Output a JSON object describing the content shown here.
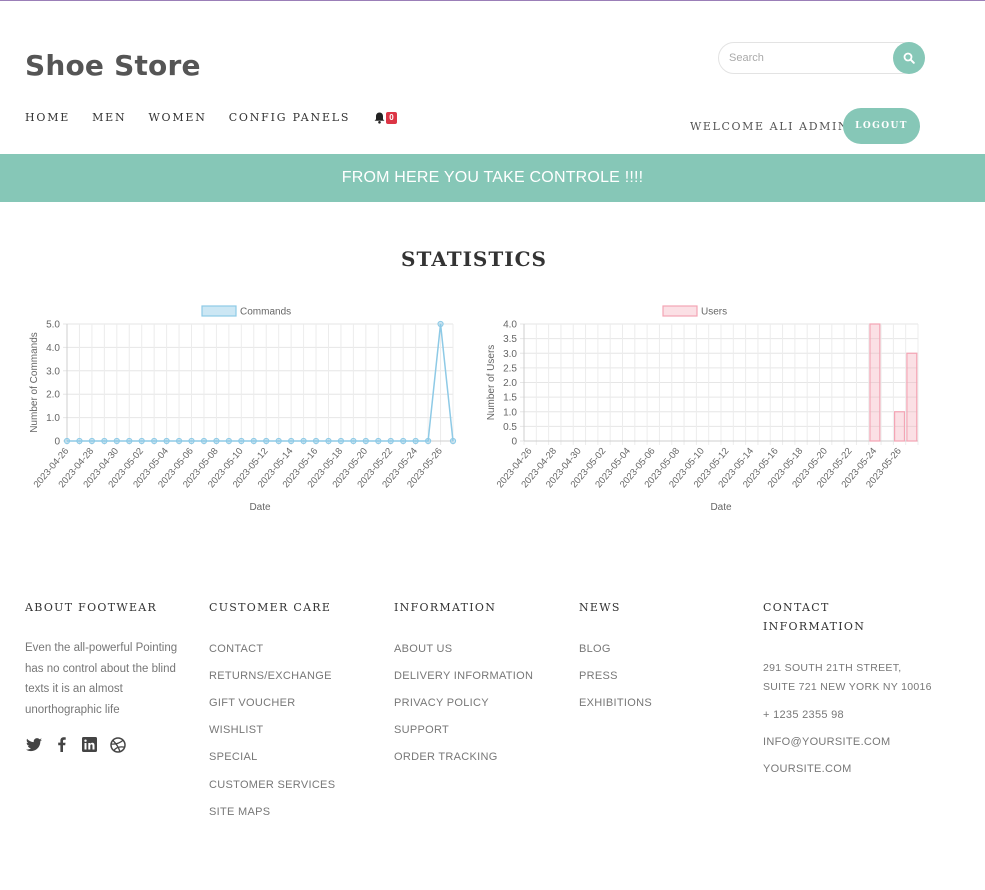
{
  "header": {
    "brand": "Shoe Store",
    "search_placeholder": "Search",
    "nav": [
      "HOME",
      "MEN",
      "WOMEN",
      "CONFIG PANELS"
    ],
    "notification_count": "0",
    "welcome": "WELCOME ALI ADMIN",
    "logout_label": "LOGOUT"
  },
  "banner": {
    "text": "FROM HERE YOU TAKE CONTROLE !!!!"
  },
  "stats": {
    "title": "STATISTICS"
  },
  "colors": {
    "accent": "#86c7b7",
    "badge": "#dc3545",
    "commands_line": "#8ecae6",
    "users_bar": "#f4a5b5"
  },
  "chart_data": [
    {
      "type": "line",
      "legend": "Commands",
      "xlabel": "Date",
      "ylabel": "Number of Commands",
      "ylim": [
        0,
        5
      ],
      "yticks": [
        "0",
        "1.0",
        "2.0",
        "3.0",
        "4.0",
        "5.0"
      ],
      "x": [
        "2023-04-26",
        "2023-04-27",
        "2023-04-28",
        "2023-04-29",
        "2023-04-30",
        "2023-05-01",
        "2023-05-02",
        "2023-05-03",
        "2023-05-04",
        "2023-05-05",
        "2023-05-06",
        "2023-05-07",
        "2023-05-08",
        "2023-05-09",
        "2023-05-10",
        "2023-05-11",
        "2023-05-12",
        "2023-05-13",
        "2023-05-14",
        "2023-05-15",
        "2023-05-16",
        "2023-05-17",
        "2023-05-18",
        "2023-05-19",
        "2023-05-20",
        "2023-05-21",
        "2023-05-22",
        "2023-05-23",
        "2023-05-24",
        "2023-05-25",
        "2023-05-26",
        "2023-05-27"
      ],
      "xtick_labels": [
        "2023-04-26",
        "2023-04-28",
        "2023-04-30",
        "2023-05-02",
        "2023-05-04",
        "2023-05-06",
        "2023-05-08",
        "2023-05-10",
        "2023-05-12",
        "2023-05-14",
        "2023-05-16",
        "2023-05-18",
        "2023-05-20",
        "2023-05-22",
        "2023-05-24",
        "2023-05-26"
      ],
      "values": [
        0,
        0,
        0,
        0,
        0,
        0,
        0,
        0,
        0,
        0,
        0,
        0,
        0,
        0,
        0,
        0,
        0,
        0,
        0,
        0,
        0,
        0,
        0,
        0,
        0,
        0,
        0,
        0,
        0,
        0,
        5,
        0
      ]
    },
    {
      "type": "bar",
      "legend": "Users",
      "xlabel": "Date",
      "ylabel": "Number of Users",
      "ylim": [
        0,
        4
      ],
      "yticks": [
        "0",
        "0.5",
        "1.0",
        "1.5",
        "2.0",
        "2.5",
        "3.0",
        "3.5",
        "4.0"
      ],
      "x": [
        "2023-04-26",
        "2023-04-27",
        "2023-04-28",
        "2023-04-29",
        "2023-04-30",
        "2023-05-01",
        "2023-05-02",
        "2023-05-03",
        "2023-05-04",
        "2023-05-05",
        "2023-05-06",
        "2023-05-07",
        "2023-05-08",
        "2023-05-09",
        "2023-05-10",
        "2023-05-11",
        "2023-05-12",
        "2023-05-13",
        "2023-05-14",
        "2023-05-15",
        "2023-05-16",
        "2023-05-17",
        "2023-05-18",
        "2023-05-19",
        "2023-05-20",
        "2023-05-21",
        "2023-05-22",
        "2023-05-23",
        "2023-05-24",
        "2023-05-25",
        "2023-05-26",
        "2023-05-27"
      ],
      "xtick_labels": [
        "2023-04-26",
        "2023-04-28",
        "2023-04-30",
        "2023-05-02",
        "2023-05-04",
        "2023-05-06",
        "2023-05-08",
        "2023-05-10",
        "2023-05-12",
        "2023-05-14",
        "2023-05-16",
        "2023-05-18",
        "2023-05-20",
        "2023-05-22",
        "2023-05-24",
        "2023-05-26"
      ],
      "values": [
        0,
        0,
        0,
        0,
        0,
        0,
        0,
        0,
        0,
        0,
        0,
        0,
        0,
        0,
        0,
        0,
        0,
        0,
        0,
        0,
        0,
        0,
        0,
        0,
        0,
        0,
        0,
        0,
        4,
        0,
        1,
        3
      ]
    }
  ],
  "footer": {
    "about": {
      "title": "ABOUT FOOTWEAR",
      "text": "Even the all-powerful Pointing has no control about the blind texts it is an almost unorthographic life",
      "social": [
        "twitter-icon",
        "facebook-icon",
        "linkedin-icon",
        "dribbble-icon"
      ]
    },
    "customer_care": {
      "title": "CUSTOMER CARE",
      "links": [
        "CONTACT",
        "RETURNS/EXCHANGE",
        "GIFT VOUCHER",
        "WISHLIST",
        "SPECIAL",
        "CUSTOMER SERVICES",
        "SITE MAPS"
      ]
    },
    "information": {
      "title": "INFORMATION",
      "links": [
        "ABOUT US",
        "DELIVERY INFORMATION",
        "PRIVACY POLICY",
        "SUPPORT",
        "ORDER TRACKING"
      ]
    },
    "news": {
      "title": "NEWS",
      "links": [
        "BLOG",
        "PRESS",
        "EXHIBITIONS"
      ]
    },
    "contact": {
      "title_line1": "CONTACT",
      "title_line2": "INFORMATION",
      "address_line1": "291 SOUTH 21TH STREET,",
      "address_line2": "SUITE 721 NEW YORK NY 10016",
      "phone": "+ 1235 2355 98",
      "email": "INFO@YOURSITE.COM",
      "website": "YOURSITE.COM"
    }
  }
}
